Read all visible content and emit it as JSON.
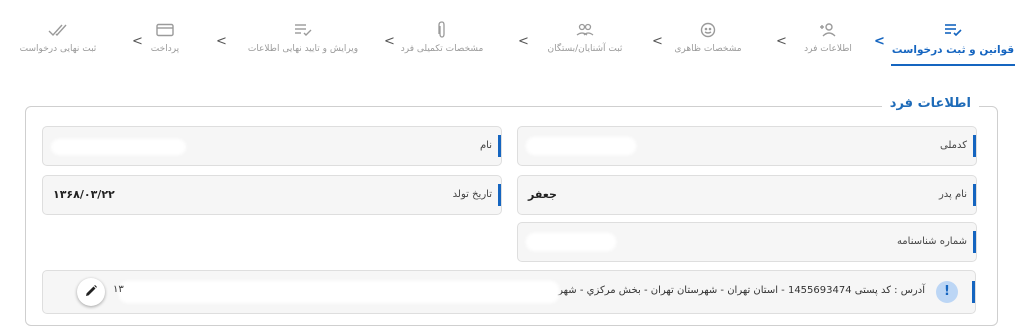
{
  "stepper": {
    "steps": [
      {
        "label": "قوانین و ثبت درخواست",
        "icon": "checklist-icon",
        "active": true
      },
      {
        "label": "اطلاعات فرد",
        "icon": "add-person-icon"
      },
      {
        "label": "مشخصات ظاهری",
        "icon": "face-icon"
      },
      {
        "label": "ثبت آشنایان/بستگان",
        "icon": "group-icon"
      },
      {
        "label": "مشخصات تکمیلی فرد",
        "icon": "attachment-icon"
      },
      {
        "label": "ویرایش و تایید نهایی اطلاعات",
        "icon": "checklist-icon"
      },
      {
        "label": "پرداخت",
        "icon": "card-icon"
      },
      {
        "label": "ثبت نهایی درخواست",
        "icon": "double-check-icon"
      }
    ],
    "accent": "#1565c0"
  },
  "section": {
    "title": "اطلاعات فرد"
  },
  "fields": {
    "national_code_label": "کدملی",
    "name_label": "نام",
    "father_name_label": "نام پدر",
    "father_name_value": "جعفر",
    "birth_date_label": "تاریخ تولد",
    "birth_date_value": "۱۳۶۸/۰۳/۲۲",
    "id_number_label": "شماره شناسنامه"
  },
  "address": {
    "text": "آدرس : کد پستی 1455693474 - استان تهران - شهرستان تهران - بخش مرکزي - شهر تهران -",
    "partial_visible": "۱۳"
  }
}
